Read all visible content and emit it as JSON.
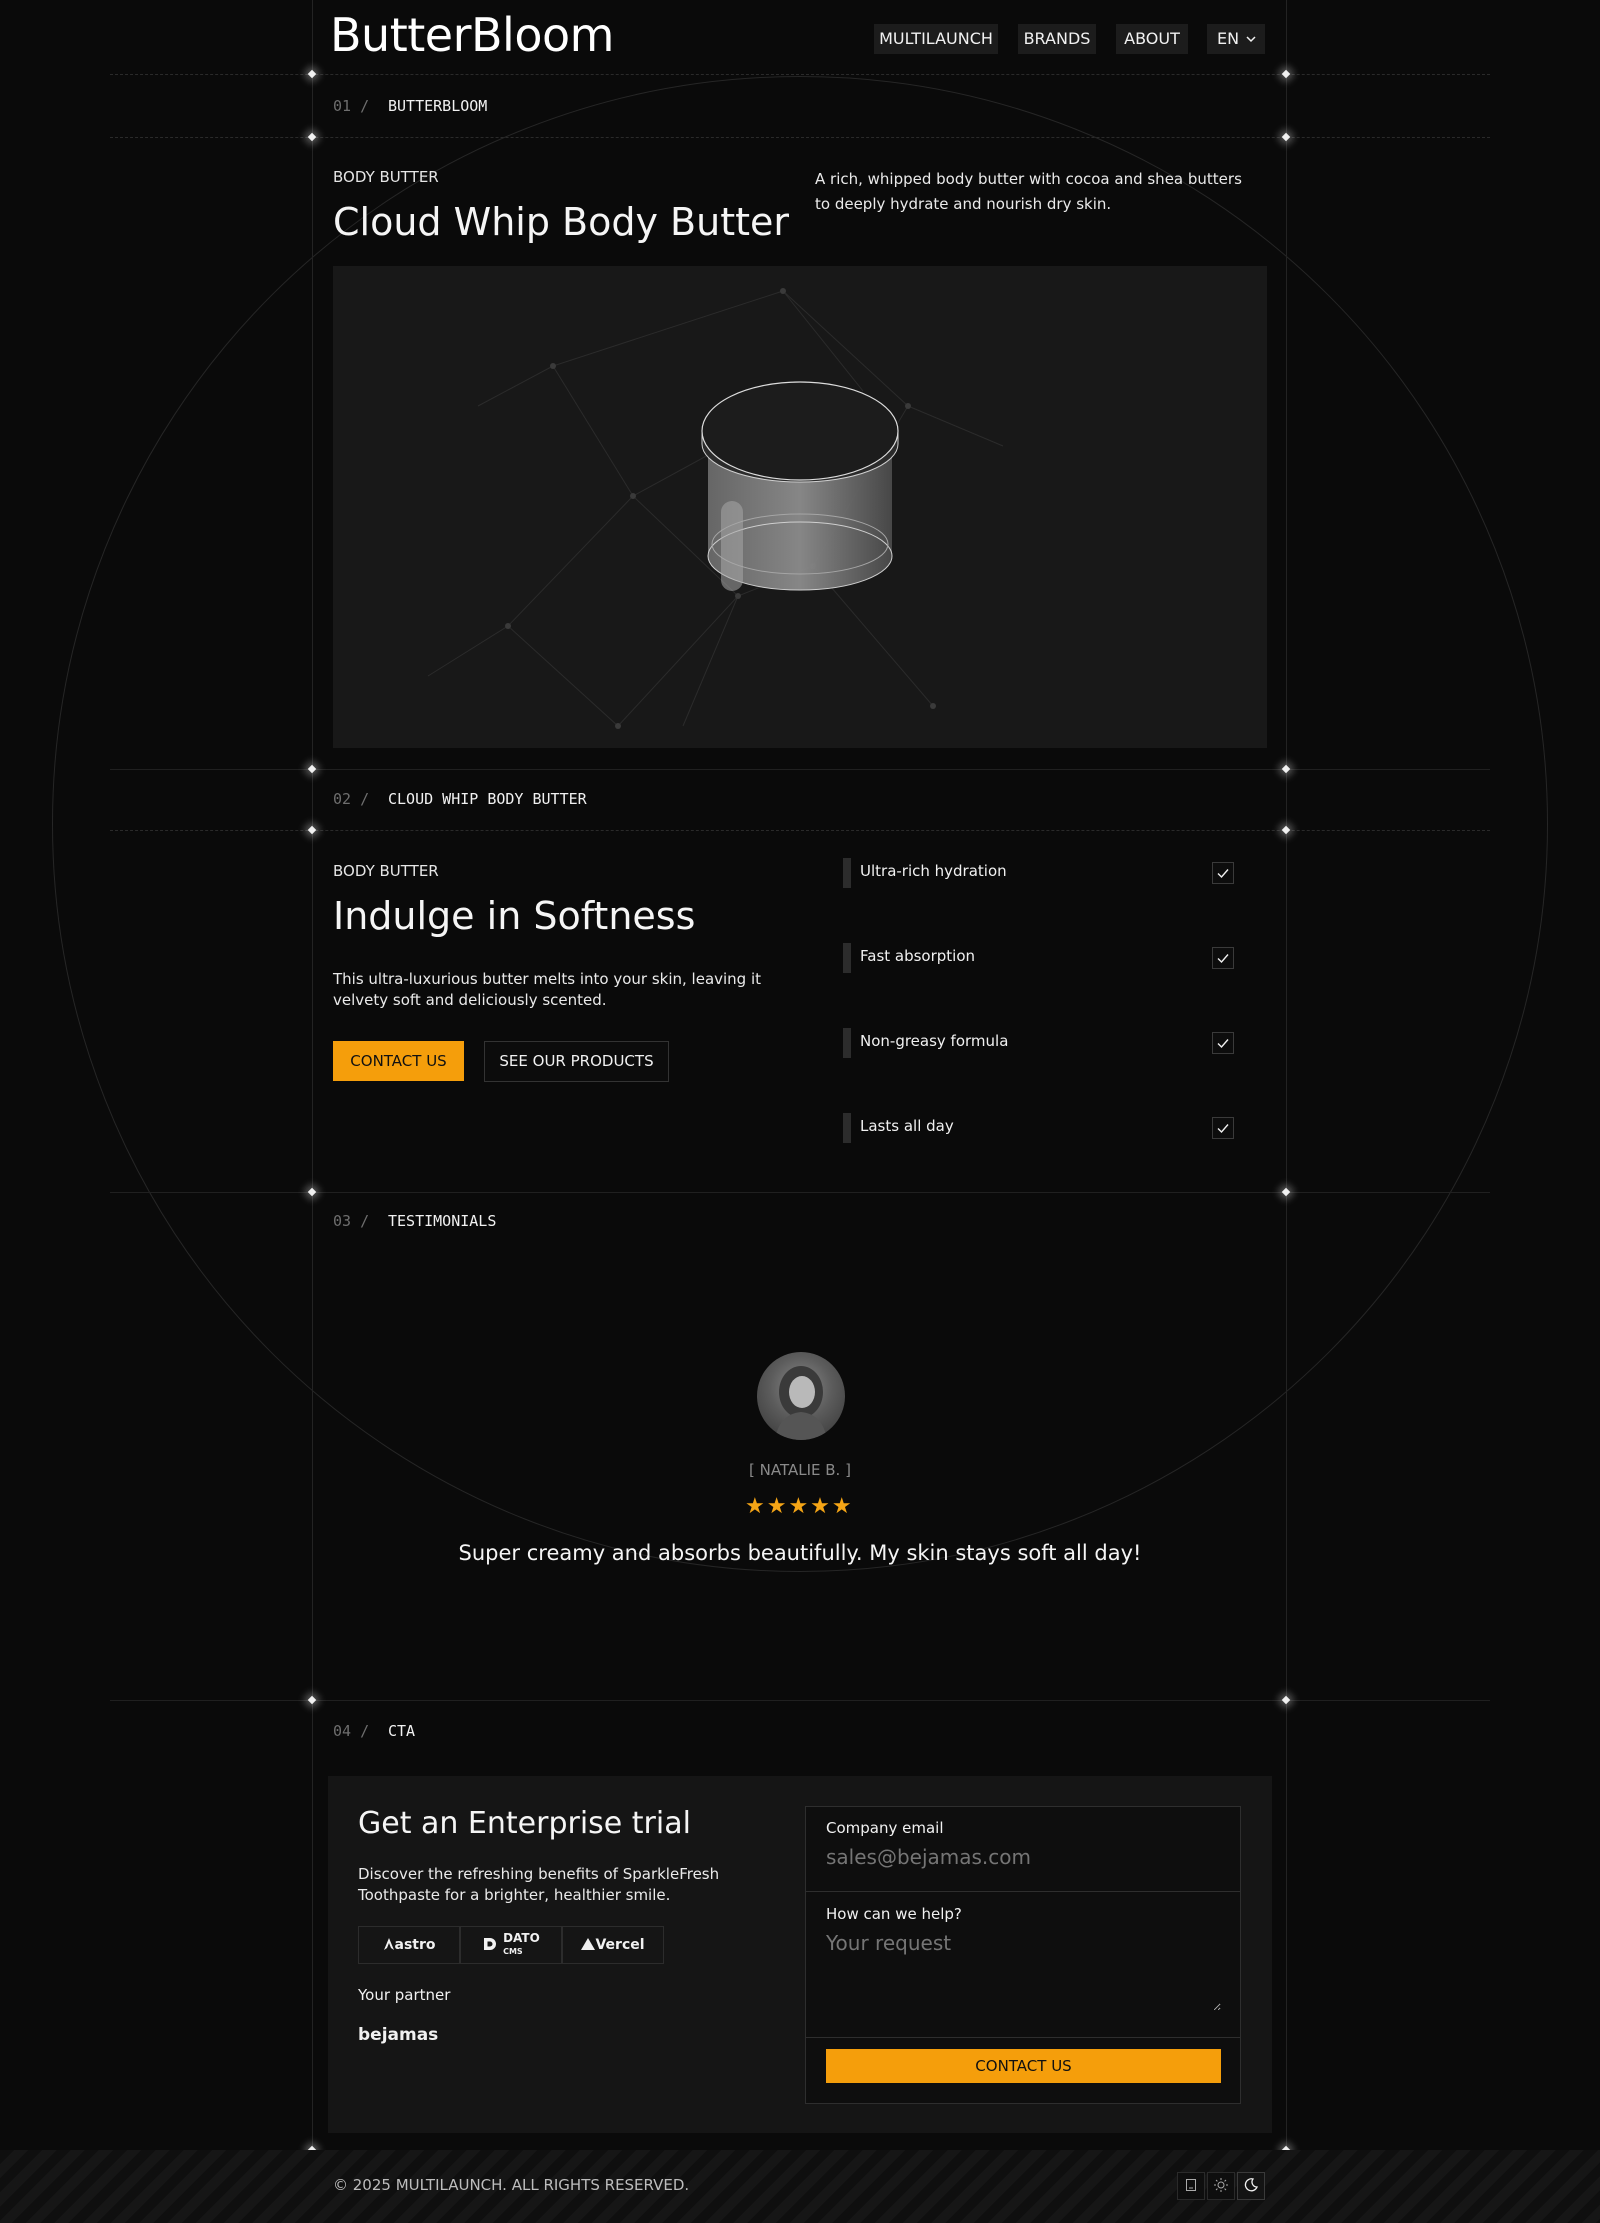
{
  "header": {
    "brand": "ButterBloom",
    "nav": [
      "MULTILAUNCH",
      "BRANDS",
      "ABOUT"
    ],
    "lang": "EN"
  },
  "section1": {
    "num": "01 /",
    "label": "BUTTERBLOOM",
    "eyebrow": "BODY BUTTER",
    "title": "Cloud Whip Body Butter",
    "description": "A rich, whipped body butter with cocoa and shea butters to deeply hydrate and nourish dry skin."
  },
  "section2": {
    "num": "02 /",
    "label": "CLOUD WHIP BODY BUTTER",
    "eyebrow": "BODY BUTTER",
    "title": "Indulge in Softness",
    "description": "This ultra-luxurious butter melts into your skin, leaving it velvety soft and deliciously scented.",
    "contact_btn": "CONTACT US",
    "products_btn": "SEE OUR PRODUCTS",
    "features": [
      "Ultra-rich hydration",
      "Fast absorption",
      "Non-greasy formula",
      "Lasts all day"
    ]
  },
  "section3": {
    "num": "03 /",
    "label": "TESTIMONIALS",
    "author": "[ NATALIE B. ]",
    "rating": 5,
    "stars": "★★★★★",
    "quote": "Super creamy and absorbs beautifully. My skin stays soft all day!"
  },
  "section4": {
    "num": "04 /",
    "label": "CTA",
    "title": "Get an Enterprise trial",
    "description": "Discover the refreshing benefits of SparkleFresh Toothpaste for a brighter, healthier smile.",
    "logos": [
      "astro",
      "DATO",
      "CMS",
      "Vercel"
    ],
    "partner_label": "Your partner",
    "partner_logo": "bejamas",
    "email_label": "Company email",
    "email_placeholder": "sales@bejamas.com",
    "help_label": "How can we help?",
    "help_placeholder": "Your request",
    "submit": "CONTACT US"
  },
  "footer": {
    "copyright": "© 2025 MULTILAUNCH. ALL RIGHTS RESERVED.",
    "icons": [
      "device-icon",
      "sun-icon",
      "moon-icon"
    ]
  },
  "colors": {
    "accent": "#f59e0b",
    "background": "#0a0a0a",
    "star": "#f5a516"
  }
}
